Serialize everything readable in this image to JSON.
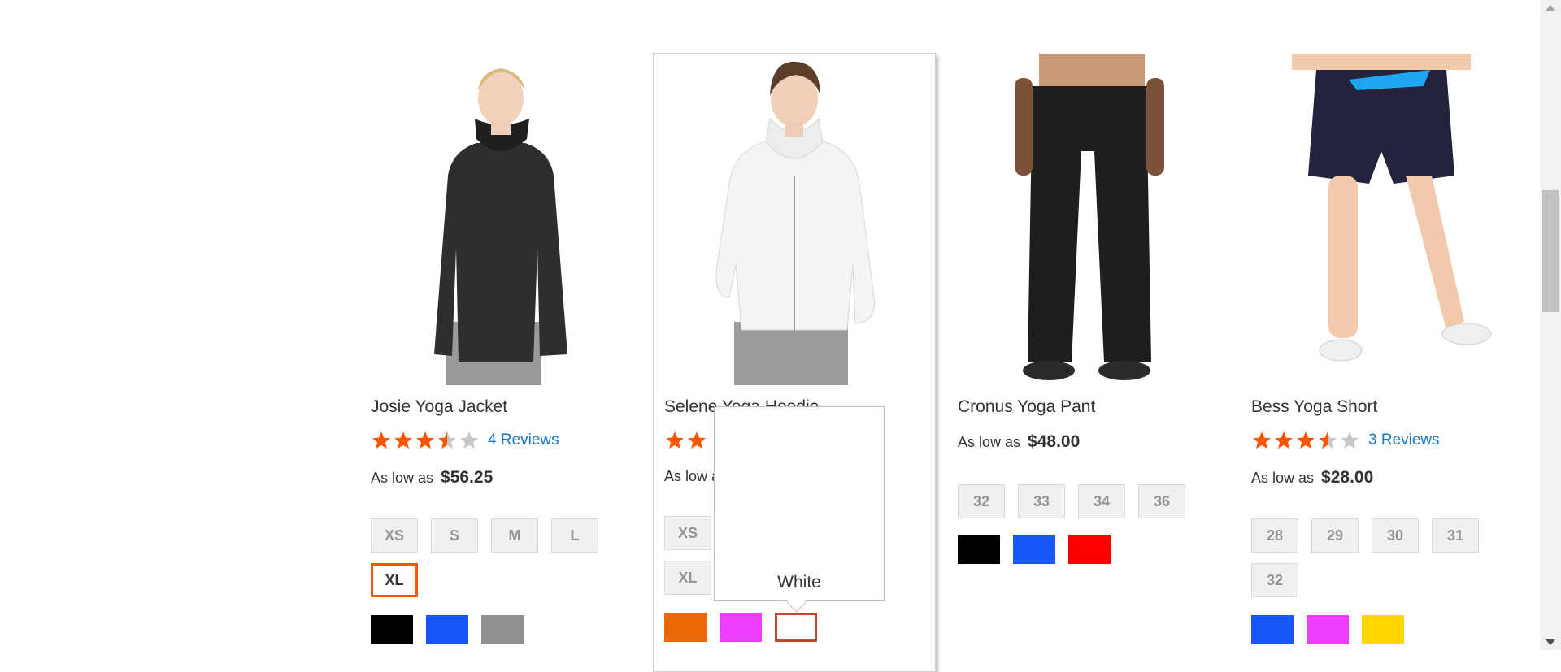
{
  "products": [
    {
      "name": "Josie Yoga Jacket",
      "rating_percent": 70,
      "reviews": "4 Reviews",
      "price_prefix": "As low as",
      "price": "$56.25",
      "sizes": [
        "XS",
        "S",
        "M",
        "L",
        "XL"
      ],
      "selected_size": "XL",
      "colors": [
        "#000000",
        "#1857f7",
        "#8f8f8f"
      ]
    },
    {
      "name": "Selene Yoga Hoodie",
      "rating_percent": 70,
      "price_prefix": "As low as",
      "sizes": [
        "XS",
        "XL"
      ],
      "colors": [
        "#eb6703",
        "#ef3dff",
        "#ffffff"
      ],
      "selected_color": "White"
    },
    {
      "name": "Cronus Yoga Pant",
      "price_prefix": "As low as",
      "price": "$48.00",
      "sizes": [
        "32",
        "33",
        "34",
        "36"
      ],
      "colors": [
        "#000000",
        "#1857f7",
        "#ff0000"
      ]
    },
    {
      "name": "Bess Yoga Short",
      "rating_percent": 70,
      "reviews": "3 Reviews",
      "price_prefix": "As low as",
      "price": "$28.00",
      "sizes": [
        "28",
        "29",
        "30",
        "31",
        "32"
      ],
      "colors": [
        "#1857f7",
        "#ef3dff",
        "#ffd500"
      ]
    }
  ],
  "tooltip": {
    "label": "White"
  },
  "colors": {
    "star": "#ff5501",
    "star_empty": "#c7c7c7",
    "link": "#1979c3",
    "selected_border": "#ff5501"
  }
}
